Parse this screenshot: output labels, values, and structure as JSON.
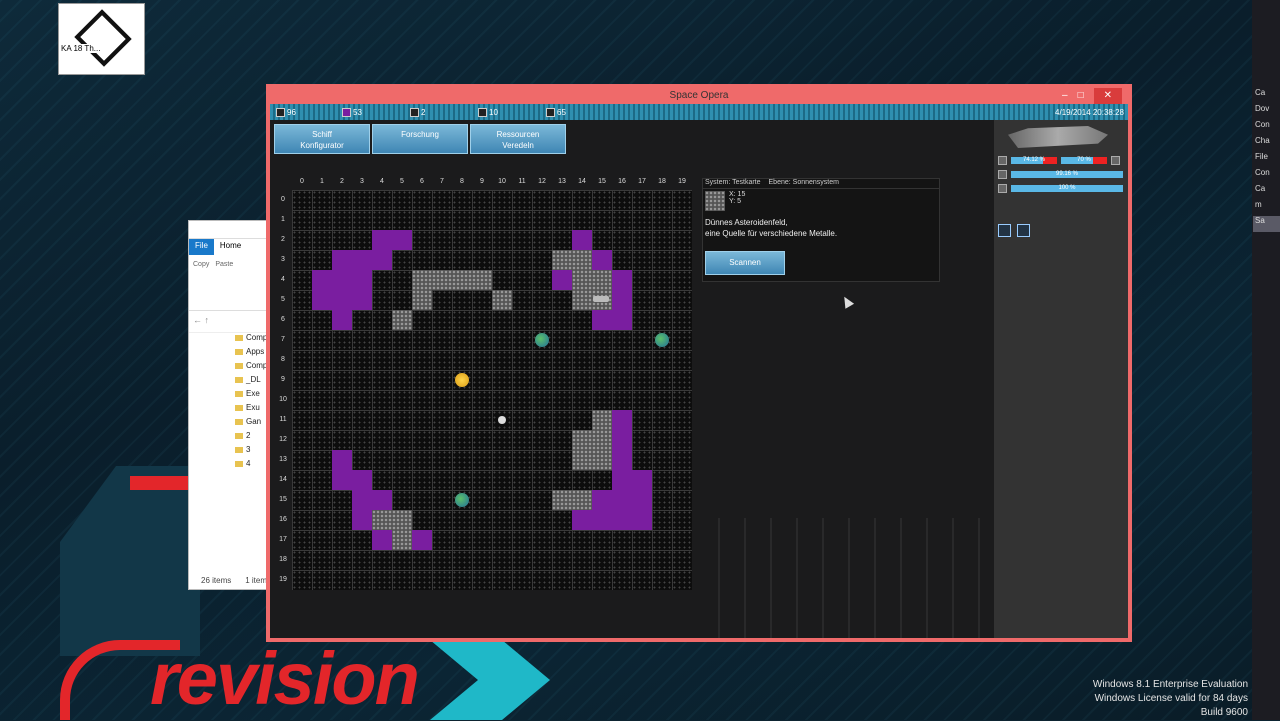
{
  "desktop": {
    "shortcut_label": "KA 18 Th...",
    "branding_text": "revision",
    "right_taskbar_items": [
      "Ca",
      "Dov",
      "Con",
      "Cha",
      "File",
      "Con",
      "Ca",
      "m",
      "Sa"
    ],
    "windows_notice": [
      "Windows 8.1 Enterprise Evaluation",
      "Windows License valid for 84 days",
      "Build 9600"
    ]
  },
  "explorer": {
    "tabs": [
      "File",
      "Home"
    ],
    "ribbon": [
      "Copy",
      "Paste"
    ],
    "tree_items": [
      "Compo",
      "Apps",
      "Comp",
      "_DL",
      "Exe",
      "Exu",
      "Gan",
      "2",
      "3",
      "4"
    ],
    "status_count": "26 items",
    "status_selected": "1 item"
  },
  "game": {
    "window_title": "Space Opera",
    "resources": [
      {
        "icon": "people-icon",
        "value": "96"
      },
      {
        "icon": "crystal-icon",
        "value": "53"
      },
      {
        "icon": "ship-icon",
        "value": "2"
      },
      {
        "icon": "factory-icon",
        "value": "10"
      },
      {
        "icon": "module-icon",
        "value": "65"
      }
    ],
    "datetime": "4/19/2014 20:38:28",
    "menu_buttons": [
      {
        "line1": "Schiff",
        "line2": "Konfigurator"
      },
      {
        "line1": "Forschung",
        "line2": ""
      },
      {
        "line1": "Ressourcen",
        "line2": "Veredeln"
      }
    ],
    "columns": [
      "0",
      "1",
      "2",
      "3",
      "4",
      "5",
      "6",
      "7",
      "8",
      "9",
      "10",
      "11",
      "12",
      "13",
      "14",
      "15",
      "16",
      "17",
      "18",
      "19"
    ],
    "rows": [
      "0",
      "1",
      "2",
      "3",
      "4",
      "5",
      "6",
      "7",
      "8",
      "9",
      "10",
      "11",
      "12",
      "13",
      "14",
      "15",
      "16",
      "17",
      "18",
      "19"
    ],
    "nebula_cells": [
      [
        4,
        2
      ],
      [
        5,
        2
      ],
      [
        2,
        3
      ],
      [
        3,
        3
      ],
      [
        4,
        3
      ],
      [
        1,
        4
      ],
      [
        2,
        4
      ],
      [
        3,
        4
      ],
      [
        1,
        5
      ],
      [
        2,
        5
      ],
      [
        3,
        5
      ],
      [
        2,
        6
      ],
      [
        14,
        2
      ],
      [
        15,
        3
      ],
      [
        13,
        4
      ],
      [
        16,
        4
      ],
      [
        16,
        5
      ],
      [
        15,
        6
      ],
      [
        16,
        6
      ],
      [
        16,
        11
      ],
      [
        16,
        12
      ],
      [
        2,
        13
      ],
      [
        2,
        14
      ],
      [
        3,
        14
      ],
      [
        16,
        13
      ],
      [
        16,
        14
      ],
      [
        17,
        14
      ],
      [
        3,
        15
      ],
      [
        4,
        15
      ],
      [
        15,
        15
      ],
      [
        16,
        15
      ],
      [
        17,
        15
      ],
      [
        3,
        16
      ],
      [
        14,
        16
      ],
      [
        15,
        16
      ],
      [
        16,
        16
      ],
      [
        17,
        16
      ],
      [
        4,
        17
      ],
      [
        6,
        17
      ]
    ],
    "asteroid_cells": [
      [
        13,
        3
      ],
      [
        14,
        3
      ],
      [
        6,
        4
      ],
      [
        7,
        4
      ],
      [
        8,
        4
      ],
      [
        9,
        4
      ],
      [
        14,
        4
      ],
      [
        15,
        4
      ],
      [
        6,
        5
      ],
      [
        10,
        5
      ],
      [
        14,
        5
      ],
      [
        15,
        5
      ],
      [
        5,
        6
      ],
      [
        15,
        11
      ],
      [
        14,
        12
      ],
      [
        15,
        12
      ],
      [
        14,
        13
      ],
      [
        15,
        13
      ],
      [
        13,
        15
      ],
      [
        14,
        15
      ],
      [
        4,
        16
      ],
      [
        5,
        16
      ],
      [
        5,
        17
      ]
    ],
    "info": {
      "system_label": "System: Testkarte",
      "level_label": "Ebene: Sonnensystem",
      "x": "X: 15",
      "y": "Y: 5",
      "description_line1": "Dünnes Asteroidenfeld,",
      "description_line2": "eine Quelle für verschiedene Metalle.",
      "scan_button": "Scannen"
    },
    "ship_status": {
      "hull_pct": "74.12 %",
      "shield_pct": "70 %",
      "cargo_pct": "99.16 %",
      "energy_pct": "100 %"
    }
  }
}
